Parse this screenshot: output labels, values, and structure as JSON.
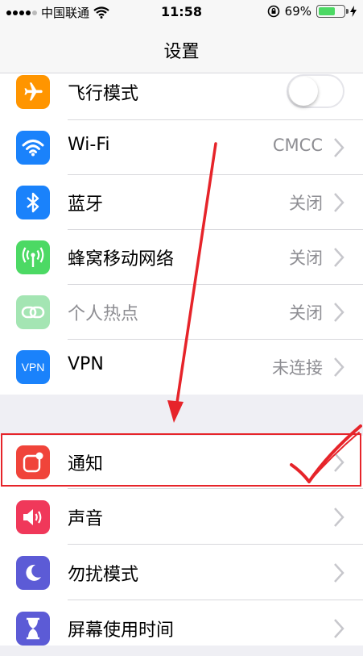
{
  "status_bar": {
    "carrier": "中国联通",
    "time": "11:58",
    "battery_percent": "69%",
    "battery_level": 0.69
  },
  "nav": {
    "title": "设置"
  },
  "rows": [
    {
      "id": "airplane",
      "label": "飞行模式",
      "icon": "airplane-icon",
      "color": "#ff9500",
      "toggle": false
    },
    {
      "id": "wifi",
      "label": "Wi-Fi",
      "value": "CMCC",
      "icon": "wifi-icon",
      "color": "#1a82fb"
    },
    {
      "id": "bluetooth",
      "label": "蓝牙",
      "value": "关闭",
      "icon": "bluetooth-icon",
      "color": "#1a82fb"
    },
    {
      "id": "cellular",
      "label": "蜂窝移动网络",
      "value": "关闭",
      "icon": "cellular-antenna-icon",
      "color": "#4cd964"
    },
    {
      "id": "hotspot",
      "label": "个人热点",
      "value": "关闭",
      "icon": "hotspot-link-icon",
      "color": "#a4e5b3",
      "dimmed": true
    },
    {
      "id": "vpn",
      "label": "VPN",
      "value": "未连接",
      "icon": "vpn-icon",
      "color": "#1a82fb",
      "icon_text": "VPN"
    },
    {
      "id": "notifications",
      "label": "通知",
      "icon": "notifications-icon",
      "color": "#f0443a",
      "highlighted": true
    },
    {
      "id": "sounds",
      "label": "声音",
      "icon": "speaker-icon",
      "color": "#f0385a"
    },
    {
      "id": "dnd",
      "label": "勿扰模式",
      "icon": "moon-icon",
      "color": "#5c5bd6"
    },
    {
      "id": "screentime",
      "label": "屏幕使用时间",
      "icon": "hourglass-icon",
      "color": "#5c5bd6"
    }
  ],
  "colors": {
    "annotation": "#e6242a",
    "chevron": "#c7c7cc",
    "secondary_text": "#8e8e93"
  }
}
